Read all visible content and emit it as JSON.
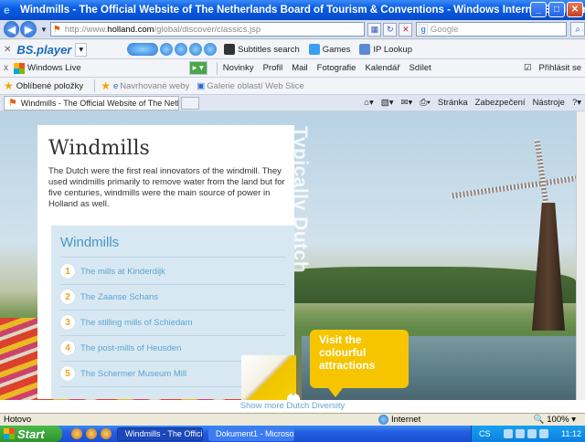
{
  "window": {
    "title": "Windmills - The Official Website of The Netherlands Board of Tourism & Conventions - Windows Internet Explorer"
  },
  "address_bar": {
    "url_prefix": "http://www.",
    "url_host": "holland.com",
    "url_path": "/global/discover/classics.jsp",
    "search_placeholder": "Google",
    "search_provider": "Google"
  },
  "toolbar_bs": {
    "brand": "BS.player",
    "subtitles": "Subtitles search",
    "games": "Games",
    "iplookup": "IP Lookup"
  },
  "toolbar_live": {
    "close": "x",
    "brand": "Windows Live",
    "items": [
      "Novinky",
      "Profil",
      "Mail",
      "Fotografie",
      "Kalendář",
      "Sdílet"
    ],
    "signin": "Přihlásit se"
  },
  "favorites_bar": {
    "favorites": "Oblíbené položky",
    "suggested": "Navrhované weby",
    "gallery": "Galerie oblastí Web Slice"
  },
  "tab": {
    "label": "Windmills - The Official Website of The Netherlands Bo...",
    "commands": [
      "Stránka",
      "Zabezpečení",
      "Nástroje"
    ]
  },
  "page": {
    "title": "Windmills",
    "intro": "The Dutch were the first real innovators of the windmill. They used windmills primarily to remove water from the land but for five centuries, windmills were the main source of power in Holland as well.",
    "list_title": "Windmills",
    "items": [
      {
        "num": "1",
        "label": "The mills at Kinderdijk"
      },
      {
        "num": "2",
        "label": "The Zaanse Schans"
      },
      {
        "num": "3",
        "label": "The stilling mills of Schiedam"
      },
      {
        "num": "4",
        "label": "The post-mills of Heusden"
      },
      {
        "num": "5",
        "label": "The Schermer Museum Mill"
      }
    ],
    "vertical_text": "Typically Dutch",
    "visit_line1": "Visit the",
    "visit_line2": "colourful",
    "visit_line3": "attractions",
    "more_link": "Show more Dutch Diversity"
  },
  "status": {
    "text": "Hotovo",
    "zone": "Internet",
    "zoom": "100%"
  },
  "taskbar": {
    "start": "Start",
    "tasks": [
      "Windmills - The Offici...",
      "Dokument1 - Microsof..."
    ],
    "lang": "CS",
    "time": "11:12"
  },
  "colors": {
    "accent_blue": "#0a5ce6",
    "link_blue": "#5aa4d0",
    "visit_yellow": "#f6c500"
  }
}
